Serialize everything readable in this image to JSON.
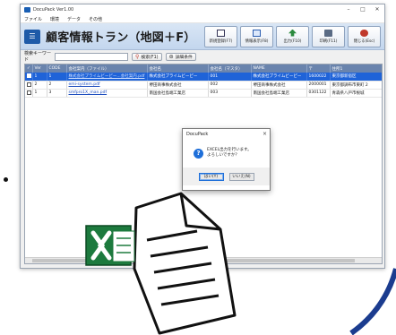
{
  "window": {
    "title": "DocuPack Ver1.00",
    "controls": [
      "–",
      "□",
      "✕"
    ]
  },
  "menu": [
    "ファイル",
    "環境",
    "データ",
    "その他"
  ],
  "header": {
    "title": "顧客情報トラン（地図＋F）",
    "buttons": [
      {
        "label": "新規登録(F7)",
        "icon": "new-document-icon"
      },
      {
        "label": "情報表示(F8)",
        "icon": "list-view-icon"
      },
      {
        "label": "出力(F10)",
        "icon": "export-icon"
      },
      {
        "label": "印刷(F11)",
        "icon": "print-icon"
      },
      {
        "label": "閉じる(Esc)",
        "icon": "close-icon"
      }
    ]
  },
  "search": {
    "label": "検索キーワード",
    "value": "",
    "search_button": "検索(F1)",
    "filter_button": "詳細条件"
  },
  "table": {
    "columns": [
      "✓",
      "Ver",
      "CODE",
      "会社案内（ファイル）",
      "会社名",
      "会社名（マスタ）",
      "NAME",
      "〒",
      "住所1"
    ],
    "rows": [
      {
        "ver": "1",
        "code": "1",
        "file": "株式会社プライムビーピー...会社案内.pdf",
        "company": "株式会社プライムビーピー",
        "master": "001",
        "name": "株式会社プライムビーピー",
        "zip": "1600022",
        "address": "東京都新宿区",
        "selected": true
      },
      {
        "ver": "2",
        "code": "2",
        "file": "emi-system.pdf",
        "company": "堺田商事株式会社",
        "master": "002",
        "name": "堺田商事株式会社",
        "zip": "2000001",
        "address": "東京都調布市東町 2",
        "selected": false
      },
      {
        "ver": "1",
        "code": "3",
        "file": "smfpro1X_man.pdf",
        "company": "南国会社島端工業店",
        "master": "003",
        "name": "南国会社島端工業店",
        "zip": "0301122",
        "address": "青森県八戸市根城",
        "selected": false
      }
    ]
  },
  "dialog": {
    "title": "DocuPack",
    "message_line1": "EXCEL出力を行います。",
    "message_line2": "よろしいですか？",
    "yes": "はい(Y)",
    "no": "いいえ(N)",
    "icon": "question-icon"
  },
  "decor": {
    "excel_icon": "excel-icon",
    "document_icon": "document-icon",
    "excel_color": "#1d7a3e",
    "accent_blue": "#1f63d8"
  }
}
